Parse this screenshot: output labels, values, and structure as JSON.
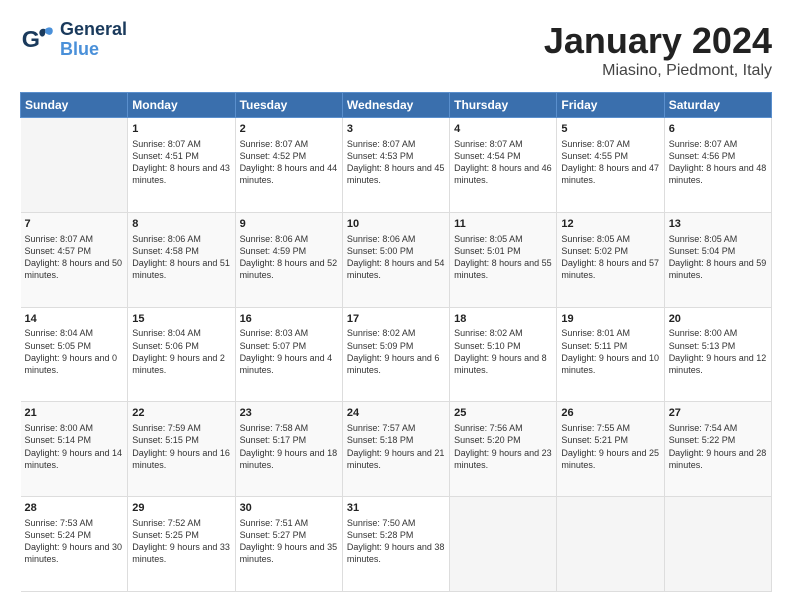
{
  "header": {
    "logo": {
      "general": "General",
      "blue": "Blue"
    },
    "title": "January 2024",
    "location": "Miasino, Piedmont, Italy"
  },
  "weekdays": [
    "Sunday",
    "Monday",
    "Tuesday",
    "Wednesday",
    "Thursday",
    "Friday",
    "Saturday"
  ],
  "weeks": [
    [
      {
        "day": "",
        "empty": true
      },
      {
        "day": "1",
        "sunrise": "Sunrise: 8:07 AM",
        "sunset": "Sunset: 4:51 PM",
        "daylight": "Daylight: 8 hours and 43 minutes."
      },
      {
        "day": "2",
        "sunrise": "Sunrise: 8:07 AM",
        "sunset": "Sunset: 4:52 PM",
        "daylight": "Daylight: 8 hours and 44 minutes."
      },
      {
        "day": "3",
        "sunrise": "Sunrise: 8:07 AM",
        "sunset": "Sunset: 4:53 PM",
        "daylight": "Daylight: 8 hours and 45 minutes."
      },
      {
        "day": "4",
        "sunrise": "Sunrise: 8:07 AM",
        "sunset": "Sunset: 4:54 PM",
        "daylight": "Daylight: 8 hours and 46 minutes."
      },
      {
        "day": "5",
        "sunrise": "Sunrise: 8:07 AM",
        "sunset": "Sunset: 4:55 PM",
        "daylight": "Daylight: 8 hours and 47 minutes."
      },
      {
        "day": "6",
        "sunrise": "Sunrise: 8:07 AM",
        "sunset": "Sunset: 4:56 PM",
        "daylight": "Daylight: 8 hours and 48 minutes."
      }
    ],
    [
      {
        "day": "7",
        "sunrise": "Sunrise: 8:07 AM",
        "sunset": "Sunset: 4:57 PM",
        "daylight": "Daylight: 8 hours and 50 minutes."
      },
      {
        "day": "8",
        "sunrise": "Sunrise: 8:06 AM",
        "sunset": "Sunset: 4:58 PM",
        "daylight": "Daylight: 8 hours and 51 minutes."
      },
      {
        "day": "9",
        "sunrise": "Sunrise: 8:06 AM",
        "sunset": "Sunset: 4:59 PM",
        "daylight": "Daylight: 8 hours and 52 minutes."
      },
      {
        "day": "10",
        "sunrise": "Sunrise: 8:06 AM",
        "sunset": "Sunset: 5:00 PM",
        "daylight": "Daylight: 8 hours and 54 minutes."
      },
      {
        "day": "11",
        "sunrise": "Sunrise: 8:05 AM",
        "sunset": "Sunset: 5:01 PM",
        "daylight": "Daylight: 8 hours and 55 minutes."
      },
      {
        "day": "12",
        "sunrise": "Sunrise: 8:05 AM",
        "sunset": "Sunset: 5:02 PM",
        "daylight": "Daylight: 8 hours and 57 minutes."
      },
      {
        "day": "13",
        "sunrise": "Sunrise: 8:05 AM",
        "sunset": "Sunset: 5:04 PM",
        "daylight": "Daylight: 8 hours and 59 minutes."
      }
    ],
    [
      {
        "day": "14",
        "sunrise": "Sunrise: 8:04 AM",
        "sunset": "Sunset: 5:05 PM",
        "daylight": "Daylight: 9 hours and 0 minutes."
      },
      {
        "day": "15",
        "sunrise": "Sunrise: 8:04 AM",
        "sunset": "Sunset: 5:06 PM",
        "daylight": "Daylight: 9 hours and 2 minutes."
      },
      {
        "day": "16",
        "sunrise": "Sunrise: 8:03 AM",
        "sunset": "Sunset: 5:07 PM",
        "daylight": "Daylight: 9 hours and 4 minutes."
      },
      {
        "day": "17",
        "sunrise": "Sunrise: 8:02 AM",
        "sunset": "Sunset: 5:09 PM",
        "daylight": "Daylight: 9 hours and 6 minutes."
      },
      {
        "day": "18",
        "sunrise": "Sunrise: 8:02 AM",
        "sunset": "Sunset: 5:10 PM",
        "daylight": "Daylight: 9 hours and 8 minutes."
      },
      {
        "day": "19",
        "sunrise": "Sunrise: 8:01 AM",
        "sunset": "Sunset: 5:11 PM",
        "daylight": "Daylight: 9 hours and 10 minutes."
      },
      {
        "day": "20",
        "sunrise": "Sunrise: 8:00 AM",
        "sunset": "Sunset: 5:13 PM",
        "daylight": "Daylight: 9 hours and 12 minutes."
      }
    ],
    [
      {
        "day": "21",
        "sunrise": "Sunrise: 8:00 AM",
        "sunset": "Sunset: 5:14 PM",
        "daylight": "Daylight: 9 hours and 14 minutes."
      },
      {
        "day": "22",
        "sunrise": "Sunrise: 7:59 AM",
        "sunset": "Sunset: 5:15 PM",
        "daylight": "Daylight: 9 hours and 16 minutes."
      },
      {
        "day": "23",
        "sunrise": "Sunrise: 7:58 AM",
        "sunset": "Sunset: 5:17 PM",
        "daylight": "Daylight: 9 hours and 18 minutes."
      },
      {
        "day": "24",
        "sunrise": "Sunrise: 7:57 AM",
        "sunset": "Sunset: 5:18 PM",
        "daylight": "Daylight: 9 hours and 21 minutes."
      },
      {
        "day": "25",
        "sunrise": "Sunrise: 7:56 AM",
        "sunset": "Sunset: 5:20 PM",
        "daylight": "Daylight: 9 hours and 23 minutes."
      },
      {
        "day": "26",
        "sunrise": "Sunrise: 7:55 AM",
        "sunset": "Sunset: 5:21 PM",
        "daylight": "Daylight: 9 hours and 25 minutes."
      },
      {
        "day": "27",
        "sunrise": "Sunrise: 7:54 AM",
        "sunset": "Sunset: 5:22 PM",
        "daylight": "Daylight: 9 hours and 28 minutes."
      }
    ],
    [
      {
        "day": "28",
        "sunrise": "Sunrise: 7:53 AM",
        "sunset": "Sunset: 5:24 PM",
        "daylight": "Daylight: 9 hours and 30 minutes."
      },
      {
        "day": "29",
        "sunrise": "Sunrise: 7:52 AM",
        "sunset": "Sunset: 5:25 PM",
        "daylight": "Daylight: 9 hours and 33 minutes."
      },
      {
        "day": "30",
        "sunrise": "Sunrise: 7:51 AM",
        "sunset": "Sunset: 5:27 PM",
        "daylight": "Daylight: 9 hours and 35 minutes."
      },
      {
        "day": "31",
        "sunrise": "Sunrise: 7:50 AM",
        "sunset": "Sunset: 5:28 PM",
        "daylight": "Daylight: 9 hours and 38 minutes."
      },
      {
        "day": "",
        "empty": true
      },
      {
        "day": "",
        "empty": true
      },
      {
        "day": "",
        "empty": true
      }
    ]
  ]
}
